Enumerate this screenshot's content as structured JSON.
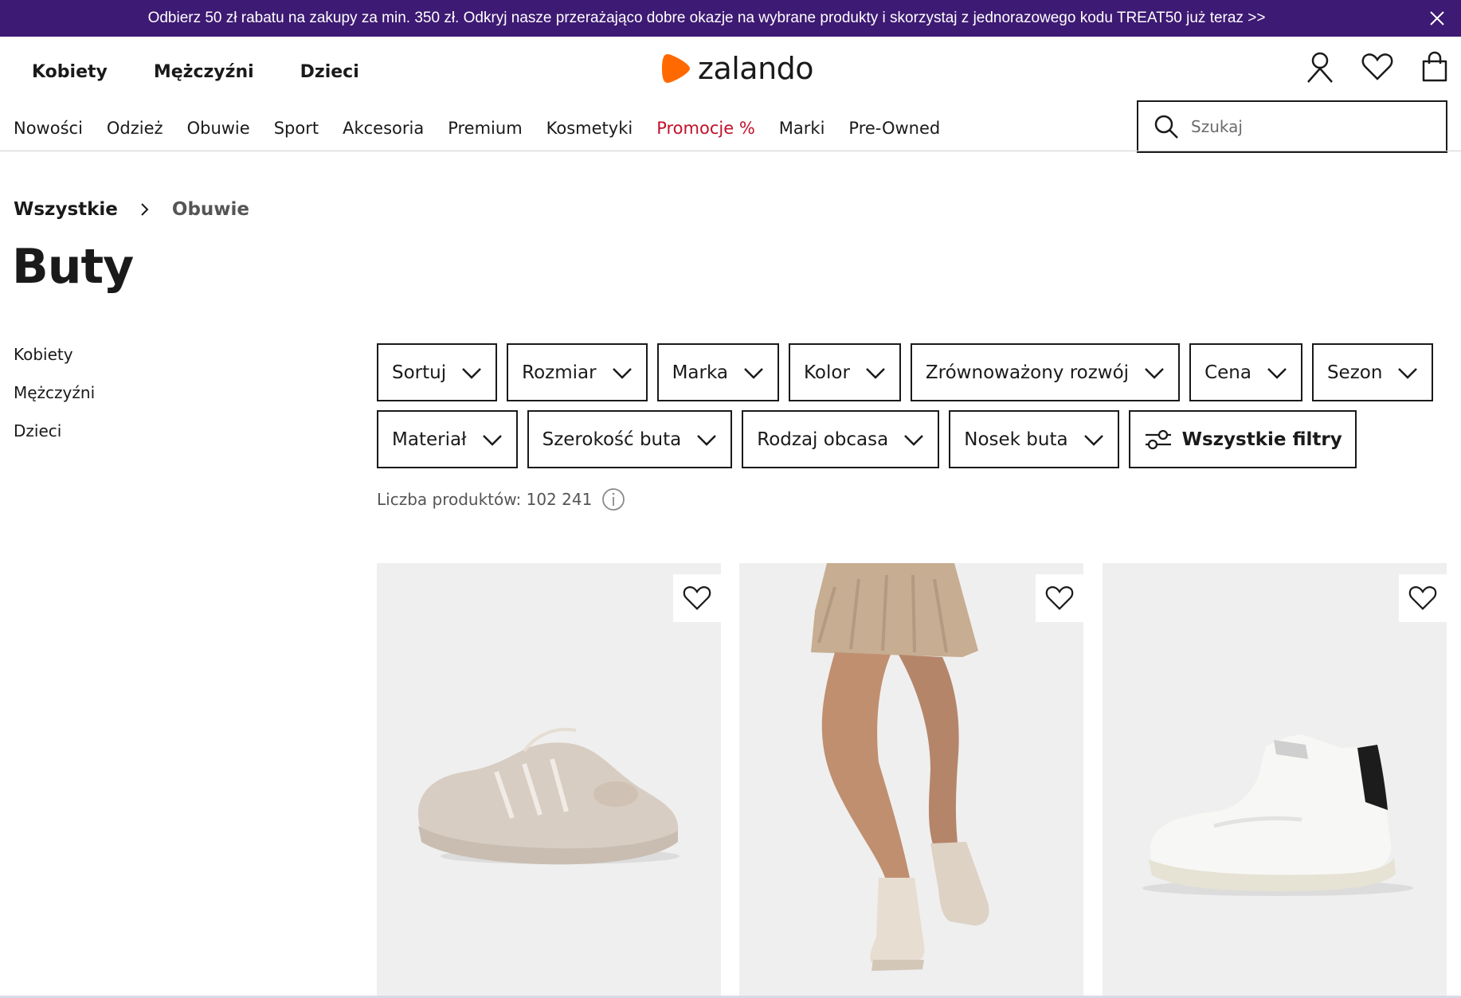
{
  "promo_banner": {
    "text": "Odbierz 50 zł rabatu na zakupy za min. 350 zł. Odkryj nasze przerażająco dobre okazje na wybrane produkty i skorzystaj z jednorazowego kodu TREAT50 już teraz >>",
    "close_icon": "close-icon",
    "background": "#3d1a73"
  },
  "header": {
    "gender_nav": [
      "Kobiety",
      "Mężczyźni",
      "Dzieci"
    ],
    "logo_text": "zalando",
    "logo_color": "#ff6900",
    "icons": [
      "user-icon",
      "heart-icon",
      "bag-icon"
    ]
  },
  "category_nav": [
    "Nowości",
    "Odzież",
    "Obuwie",
    "Sport",
    "Akcesoria",
    "Premium",
    "Kosmetyki",
    "Promocje %",
    "Marki",
    "Pre-Owned"
  ],
  "search": {
    "placeholder": "Szukaj"
  },
  "breadcrumb": {
    "root": "Wszystkie",
    "current": "Obuwie"
  },
  "page_title": "Buty",
  "sidebar": [
    "Kobiety",
    "Mężczyźni",
    "Dzieci"
  ],
  "filters": {
    "row1": [
      "Sortuj",
      "Rozmiar",
      "Marka",
      "Kolor",
      "Zrównoważony rozwój",
      "Cena",
      "Sezon"
    ],
    "row2": [
      "Materiał",
      "Szerokość buta",
      "Rodzaj obcasa",
      "Nosek buta"
    ],
    "all_filters": "Wszystkie filtry"
  },
  "product_count": "Liczba produktów: 102 241",
  "accent_red": "#c0102a"
}
